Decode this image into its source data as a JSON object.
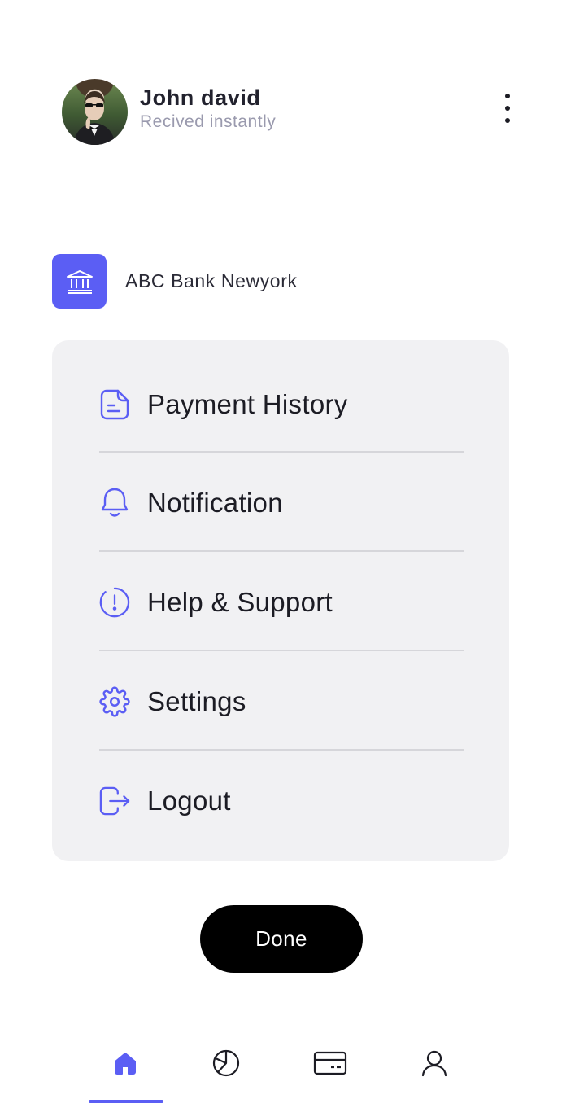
{
  "profile": {
    "name": "John david",
    "subtitle": "Recived instantly"
  },
  "bank": {
    "name": "ABC Bank Newyork",
    "icon": "bank-icon"
  },
  "menu": {
    "items": [
      {
        "label": "Payment History",
        "icon": "document-icon"
      },
      {
        "label": "Notification",
        "icon": "bell-icon"
      },
      {
        "label": "Help & Support",
        "icon": "info-alert-icon"
      },
      {
        "label": "Settings",
        "icon": "gear-icon"
      },
      {
        "label": "Logout",
        "icon": "logout-icon"
      }
    ]
  },
  "done_button": {
    "label": "Done"
  },
  "tabbar": {
    "tabs": [
      {
        "icon": "home-icon",
        "active": true
      },
      {
        "icon": "pie-chart-icon",
        "active": false
      },
      {
        "icon": "card-icon",
        "active": false
      },
      {
        "icon": "user-icon",
        "active": false
      }
    ]
  },
  "colors": {
    "accent": "#5b5ef4",
    "card_bg": "#f1f1f3",
    "text_primary": "#1c1c24",
    "text_secondary": "#9a9aae",
    "button_bg": "#000000"
  }
}
